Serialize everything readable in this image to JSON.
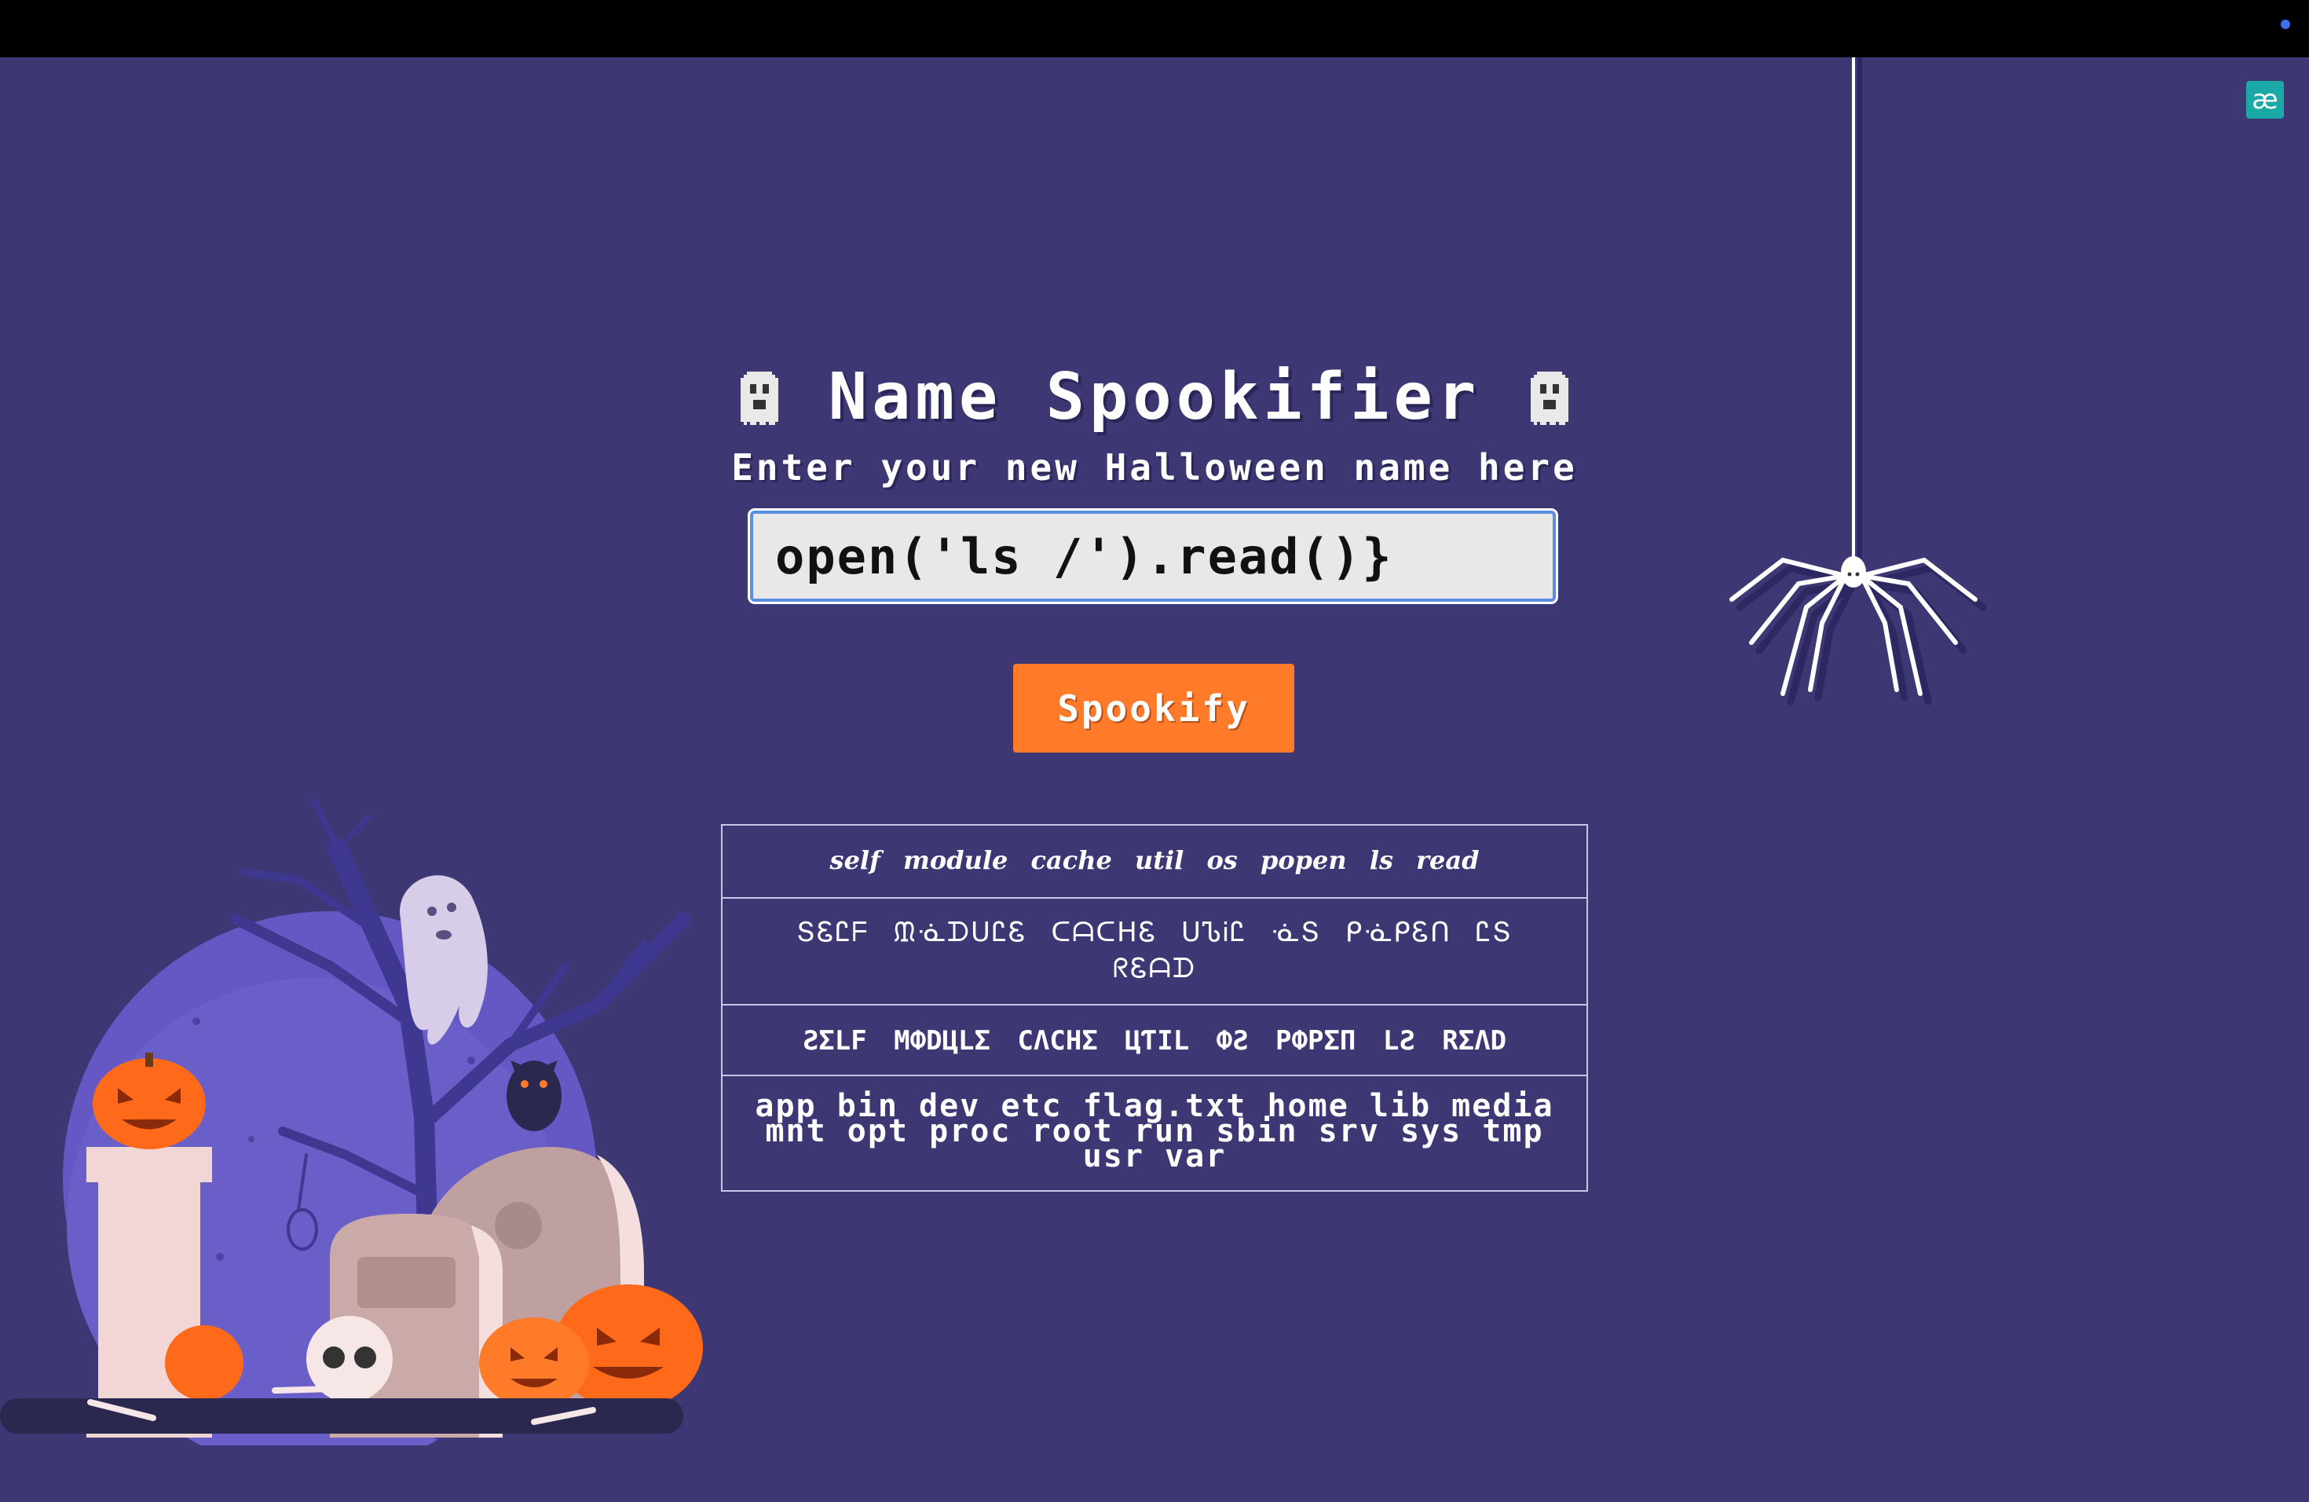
{
  "app": {
    "title": "Name Spookifier",
    "subtitle": "Enter your new Halloween name here"
  },
  "extension": {
    "label": "æ"
  },
  "form": {
    "input_value": "open('ls /').read()}",
    "button_label": "Spookify"
  },
  "results": {
    "row1": "self module cache util os popen ls read",
    "row2": "ՏᏋᏝᖴ ᙢᓍᗪᑌᏝᏋ ᑕᗩᑕᕼᏋ ᑌᏖᎥᏝ ᓍՏ ᑭᓍᑭᏋᑎ ᏝՏ ᖇᏋᗩᗪ",
    "row3": "ƧΣLF MФDЦLΣ CΛCHΣ ЦƬIL ФƧ PФPΣП LƧ RΣΛD",
    "row4": "app bin dev etc flag.txt home lib media mnt opt proc root run sbin srv sys tmp usr var"
  },
  "colors": {
    "background": "#3d3874",
    "accent": "#ff7a29",
    "input_border": "#5a8fe0"
  }
}
